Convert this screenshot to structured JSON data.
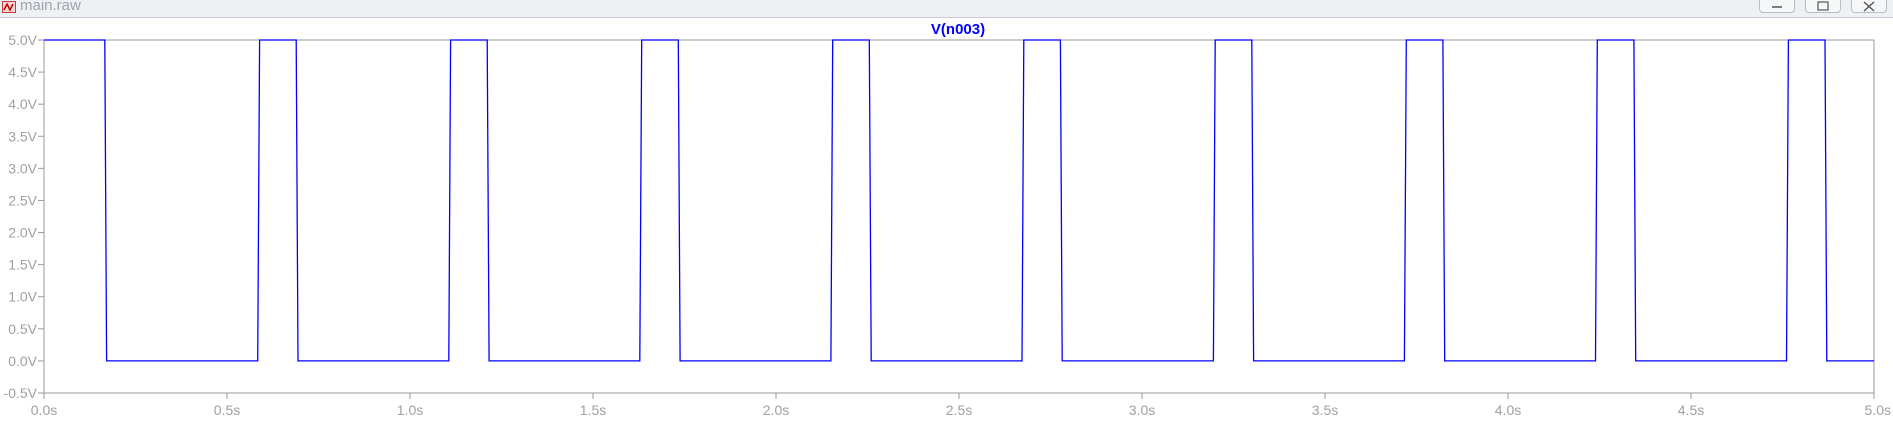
{
  "window": {
    "title": "main.raw",
    "controls": [
      "minimize",
      "maximize",
      "close"
    ]
  },
  "colors": {
    "trace": "#0000ff",
    "axis_text": "#a0a0a0",
    "frame": "#9a9a9a",
    "background": "#ffffff"
  },
  "chart_data": {
    "type": "line",
    "title": "V(n003)",
    "xlabel": "",
    "ylabel": "",
    "xlim": [
      0,
      5.0
    ],
    "ylim": [
      -0.5,
      5.0
    ],
    "xticks": [
      "0.0s",
      "0.5s",
      "1.0s",
      "1.5s",
      "2.0s",
      "2.5s",
      "3.0s",
      "3.5s",
      "4.0s",
      "4.5s",
      "5.0s"
    ],
    "yticks": [
      "-0.5V",
      "0.0V",
      "0.5V",
      "1.0V",
      "1.5V",
      "2.0V",
      "2.5V",
      "3.0V",
      "3.5V",
      "4.0V",
      "4.5V",
      "5.0V"
    ],
    "grid": false,
    "series": [
      {
        "name": "V(n003)",
        "x": [
          0.0,
          0.166,
          0.171,
          0.584,
          0.589,
          0.689,
          0.694,
          1.106,
          1.111,
          1.211,
          1.216,
          1.628,
          1.633,
          1.733,
          1.738,
          2.15,
          2.155,
          2.255,
          2.26,
          2.672,
          2.677,
          2.777,
          2.782,
          3.195,
          3.2,
          3.3,
          3.305,
          3.717,
          3.722,
          3.822,
          3.827,
          4.239,
          4.244,
          4.344,
          4.349,
          4.761,
          4.766,
          4.866,
          4.871,
          5.0
        ],
        "y": [
          5.0,
          5.0,
          0.0,
          0.0,
          5.0,
          5.0,
          0.0,
          0.0,
          5.0,
          5.0,
          0.0,
          0.0,
          5.0,
          5.0,
          0.0,
          0.0,
          5.0,
          5.0,
          0.0,
          0.0,
          5.0,
          5.0,
          0.0,
          0.0,
          5.0,
          5.0,
          0.0,
          0.0,
          5.0,
          5.0,
          0.0,
          0.0,
          5.0,
          5.0,
          0.0,
          0.0,
          5.0,
          5.0,
          0.0,
          0.0
        ]
      }
    ]
  }
}
